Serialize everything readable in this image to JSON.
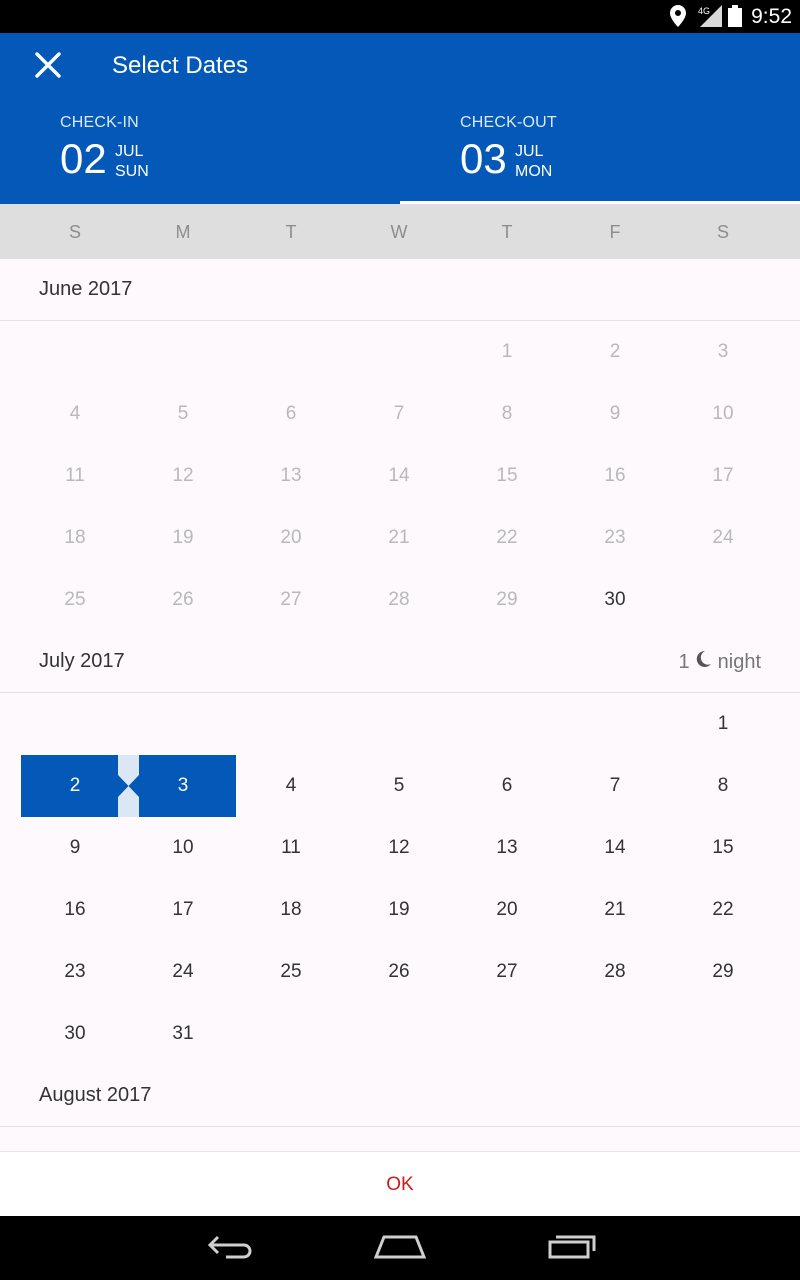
{
  "status_bar": {
    "time": "9:52",
    "network": "4G",
    "icons": [
      "location-icon",
      "signal-icon",
      "battery-icon"
    ]
  },
  "header": {
    "title": "Select Dates",
    "close_icon": "close-icon",
    "checkin": {
      "label": "CHECK-IN",
      "day": "02",
      "month": "JUL",
      "weekday": "SUN"
    },
    "checkout": {
      "label": "CHECK-OUT",
      "day": "03",
      "month": "JUL",
      "weekday": "MON"
    }
  },
  "weekdays": [
    "S",
    "M",
    "T",
    "W",
    "T",
    "F",
    "S"
  ],
  "months": [
    {
      "label": "June 2017"
    },
    {
      "label": "July 2017",
      "nights_count": "1",
      "nights_label": "night",
      "nights_icon": "moon-icon"
    },
    {
      "label": "August 2017"
    }
  ],
  "june_days": [
    "1",
    "2",
    "3",
    "4",
    "5",
    "6",
    "7",
    "8",
    "9",
    "10",
    "11",
    "12",
    "13",
    "14",
    "15",
    "16",
    "17",
    "18",
    "19",
    "20",
    "21",
    "22",
    "23",
    "24",
    "25",
    "26",
    "27",
    "28",
    "29",
    "30"
  ],
  "july_days": [
    "1",
    "2",
    "3",
    "4",
    "5",
    "6",
    "7",
    "8",
    "9",
    "10",
    "11",
    "12",
    "13",
    "14",
    "15",
    "16",
    "17",
    "18",
    "19",
    "20",
    "21",
    "22",
    "23",
    "24",
    "25",
    "26",
    "27",
    "28",
    "29",
    "30",
    "31"
  ],
  "footer": {
    "ok_label": "OK"
  },
  "nav": {
    "buttons": [
      "back-icon",
      "home-icon",
      "recents-icon"
    ]
  },
  "colors": {
    "primary": "#0358b8",
    "ok": "#d11a1a",
    "past_day": "#b9b9b9",
    "weekday_bar": "#dedede"
  }
}
